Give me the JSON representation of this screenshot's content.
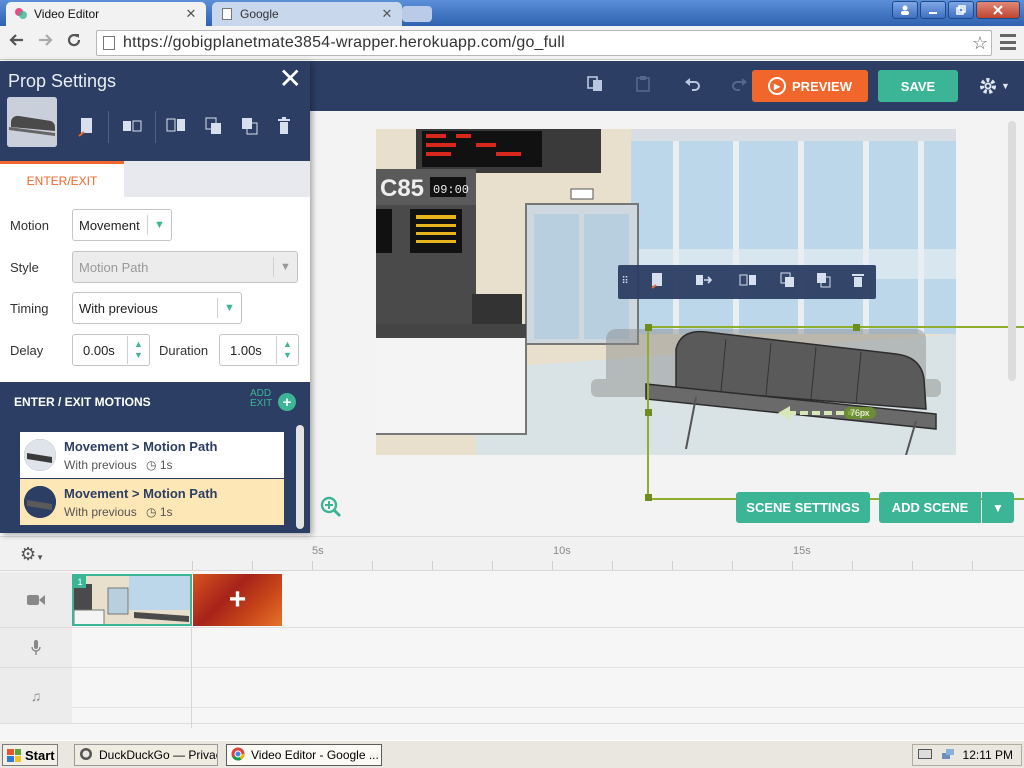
{
  "browser": {
    "tabs": [
      {
        "title": "Video Editor",
        "active": true
      },
      {
        "title": "Google",
        "active": false
      }
    ],
    "url": "https://gobigplanetmate3854-wrapper.herokuapp.com/go_full",
    "window_controls": [
      "minimize",
      "restore",
      "close"
    ]
  },
  "appbar": {
    "preview_label": "PREVIEW",
    "save_label": "SAVE",
    "colors": {
      "bar": "#2c3e63",
      "preview": "#f0662b",
      "save": "#3cb596"
    }
  },
  "prop_panel": {
    "title": "Prop Settings",
    "close_glyph": "✕",
    "tabs": [
      {
        "label": "ENTER/EXIT",
        "active": true
      }
    ],
    "fields": {
      "motion": {
        "label": "Motion",
        "value": "Movement"
      },
      "style": {
        "label": "Style",
        "value": "Motion Path",
        "disabled": true
      },
      "timing": {
        "label": "Timing",
        "value": "With previous"
      },
      "delay": {
        "label": "Delay",
        "value": "0.00s"
      },
      "duration": {
        "label": "Duration",
        "value": "1.00s"
      }
    },
    "motions_section": {
      "title": "ENTER / EXIT MOTIONS",
      "add_label_line1": "ADD",
      "add_label_line2": "EXIT",
      "add_glyph": "+"
    },
    "motions": [
      {
        "name": "Movement > Motion Path",
        "timing": "With previous",
        "duration": "1s",
        "selected": false
      },
      {
        "name": "Movement > Motion Path",
        "timing": "With previous",
        "duration": "1s",
        "selected": true
      }
    ]
  },
  "stage": {
    "board_code": "C85",
    "board_time": "09:00",
    "path_distance_label": "76px",
    "scene_settings_label": "SCENE SETTINGS",
    "add_scene_label": "ADD SCENE"
  },
  "timeline": {
    "ticks": [
      "5s",
      "10s",
      "15s"
    ],
    "scene_number": "1",
    "add_clip_glyph": "+",
    "tracks": [
      "camera-icon",
      "microphone-icon",
      "music-note-icon"
    ]
  },
  "taskbar": {
    "start_label": "Start",
    "items": [
      {
        "label": "DuckDuckGo — Privac...",
        "active": false
      },
      {
        "label": "Video Editor - Google ...",
        "active": true
      }
    ],
    "clock": "12:11 PM"
  }
}
